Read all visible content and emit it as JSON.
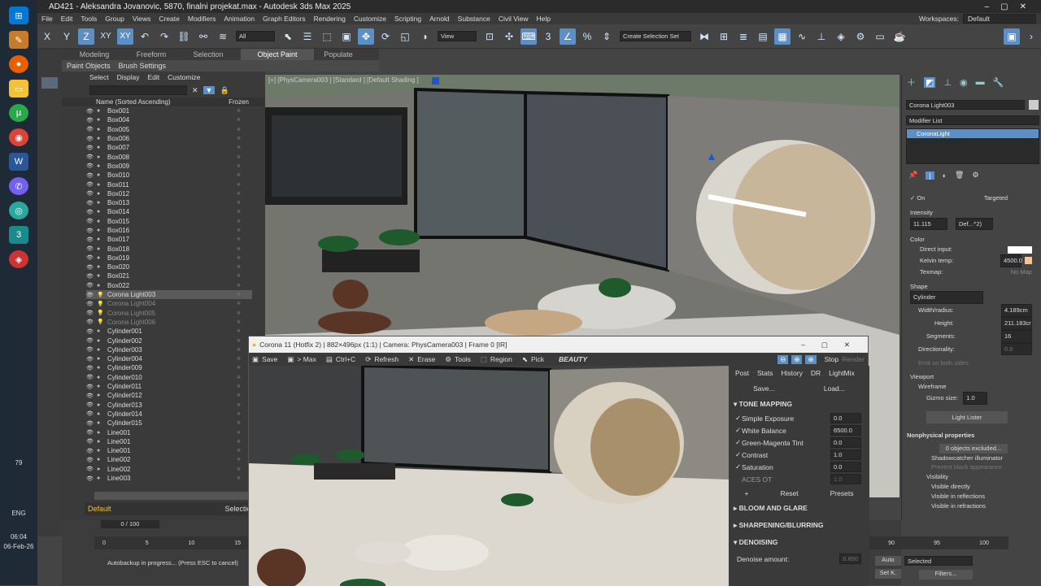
{
  "window": {
    "title": "AD421 - Aleksandra Jovanovic, 5870, finalni projekat.max - Autodesk 3ds Max 2025",
    "workspace_label": "Workspaces:",
    "workspace_value": "Default"
  },
  "menu": [
    "File",
    "Edit",
    "Tools",
    "Group",
    "Views",
    "Create",
    "Modifiers",
    "Animation",
    "Graph Editors",
    "Rendering",
    "Customize",
    "Scripting",
    "Arnold",
    "Substance",
    "Civil View",
    "Help"
  ],
  "toolbar": {
    "axis_x": "X",
    "axis_y": "Y",
    "axis_z": "Z",
    "axis_xy": "XY",
    "axis_xy2": "XY",
    "filter_all": "All",
    "view_ref": "View",
    "selection_set": "Create Selection Set"
  },
  "ribbon": {
    "tabs": [
      "Modeling",
      "Freeform",
      "Selection",
      "Object Paint",
      "Populate"
    ],
    "active": "Object Paint",
    "sub": [
      "Paint Objects",
      "Brush Settings"
    ]
  },
  "explorer": {
    "menu": [
      "Select",
      "Display",
      "Edit",
      "Customize"
    ],
    "col_name": "Name (Sorted Ascending)",
    "col_frozen": "Frozen",
    "rows": [
      "Box001",
      "Box004",
      "Box005",
      "Box006",
      "Box007",
      "Box008",
      "Box009",
      "Box010",
      "Box011",
      "Box012",
      "Box013",
      "Box014",
      "Box015",
      "Box016",
      "Box017",
      "Box018",
      "Box019",
      "Box020",
      "Box021",
      "Box022",
      "Corona Light003",
      "Corona Light004",
      "Corona Light005",
      "Corona Light006",
      "Cylinder001",
      "Cylinder002",
      "Cylinder003",
      "Cylinder004",
      "Cylinder009",
      "Cylinder010",
      "Cylinder011",
      "Cylinder012",
      "Cylinder013",
      "Cylinder014",
      "Cylinder015",
      "Line001",
      "Line001",
      "Line001",
      "Line002",
      "Line002",
      "Line003"
    ],
    "selected": "Corona Light003",
    "layer": "Default",
    "selection_set": "Selection S"
  },
  "viewport": {
    "label": "[+] [PhysCamera003 ] [Standard ] [Default Shading ]"
  },
  "command_panel": {
    "object_name": "Corona Light003",
    "modifier_list": "Modifier List",
    "stack_item": "CoronaLight",
    "on": "On",
    "targeted": "Targeted",
    "intensity_label": "Intensity",
    "intensity_value": "11.115",
    "intensity_unit": "Def...^2)",
    "color_label": "Color",
    "direct_input": "Direct input:",
    "kelvin_label": "Kelvin temp:",
    "kelvin_value": "4500.0",
    "texmap": "Texmap:",
    "no_map": "No Map",
    "shape_label": "Shape",
    "shape_value": "Cylinder",
    "width_label": "Width/radius:",
    "width_value": "4.189cm",
    "height_label": "Height:",
    "height_value": "211.183cr",
    "segments_label": "Segments:",
    "segments_value": "16",
    "directionality_label": "Directionality:",
    "directionality_value": "0.0",
    "emit_both": "Emit on both sides",
    "viewport_label": "Viewport",
    "wireframe": "Wireframe",
    "gizmo_label": "Gizmo size:",
    "gizmo_value": "1.0",
    "light_lister": "Light Lister",
    "nonphysical": "Nonphysical properties",
    "excluded": "0 objects excluded...",
    "shadowcatcher": "Shadowcatcher illuminator",
    "prevent_black": "Prevent black appearance",
    "visibility": "Visibility",
    "vis_direct": "Visible directly",
    "vis_reflect": "Visible in reflections",
    "vis_refract": "Visible in refractions"
  },
  "vfb": {
    "title": "Corona 11 (Hotfix 2) | 882×496px (1:1) | Camera: PhysCamera003 | Frame 0 [IR]",
    "tools": [
      "Save",
      "> Max",
      "Ctrl+C",
      "Refresh",
      "Erase",
      "Tools",
      "Region",
      "Pick"
    ],
    "channel": "BEAUTY",
    "stop": "Stop",
    "render": "Render",
    "tabs": [
      "Post",
      "Stats",
      "History",
      "DR",
      "LightMix"
    ],
    "save": "Save...",
    "load": "Load...",
    "tone_mapping": "TONE MAPPING",
    "params": [
      {
        "label": "Simple Exposure",
        "value": "0.0"
      },
      {
        "label": "White Balance",
        "value": "6500.0"
      },
      {
        "label": "Green-Magenta Tint",
        "value": "0.0"
      },
      {
        "label": "Contrast",
        "value": "1.0"
      },
      {
        "label": "Saturation",
        "value": "0.0"
      },
      {
        "label": "ACES OT",
        "value": "1.0"
      }
    ],
    "plus": "+",
    "reset": "Reset",
    "presets": "Presets",
    "bloom": "BLOOM AND GLARE",
    "sharpen": "SHARPENING/BLURRING",
    "denoise": "DENOISING",
    "denoise_amount": "Denoise amount:",
    "denoise_value": "0.650"
  },
  "timeline": {
    "frame": "0 / 100",
    "ticks": [
      "0",
      "5",
      "10",
      "15"
    ],
    "ticks_right": [
      "90",
      "95",
      "100"
    ],
    "status": "Autobackup in progress... (Press ESC to cancel)",
    "auto": "Auto",
    "setk": "Set K.",
    "selected": "Selected",
    "filters": "Filters..."
  },
  "system": {
    "time": "06:04",
    "date": "06-Feb-26",
    "lang": "ENG",
    "battery": "79"
  }
}
